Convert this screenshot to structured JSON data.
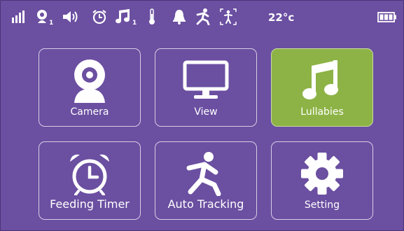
{
  "status": {
    "camera_index": "1",
    "music_index": "1",
    "temperature": "22°c"
  },
  "menu": {
    "tiles": [
      {
        "label": "Camera"
      },
      {
        "label": "View"
      },
      {
        "label": "Lullabies"
      },
      {
        "label": "Feeding Timer"
      },
      {
        "label": "Auto Tracking"
      },
      {
        "label": "Setting"
      }
    ],
    "active": "Lullabies"
  },
  "colors": {
    "background": "#6b4fa1",
    "active_tile": "#8db346",
    "tile_border": "#d8cfe6"
  }
}
